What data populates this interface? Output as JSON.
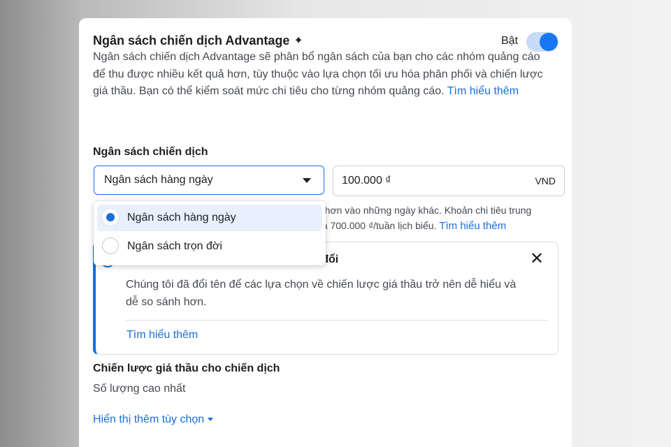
{
  "header": {
    "title": "Ngân sách chiến dịch Advantage",
    "title_icon": "sparkle-icon",
    "toggle_label": "Bật",
    "toggle_on": true
  },
  "description": {
    "text": "Ngân sách chiến dịch Advantage sẽ phân bổ ngân sách của bạn cho các nhóm quảng cáo để thu được nhiều kết quả hơn, tùy thuộc vào lựa chọn tối ưu hóa phân phối và chiến lược giá thầu. Bạn có thể kiểm soát mức chi tiêu cho từng nhóm quảng cáo.",
    "link": "Tìm hiểu thêm"
  },
  "budget": {
    "label": "Ngân sách chiến dịch",
    "type_selected": "Ngân sách hàng ngày",
    "amount": "100.000 ₫",
    "currency": "VND",
    "helper_line1": "ít hơn vào những ngày khác. Khoản chi tiêu trung",
    "helper_line2": "uá 700.000 ₫/tuần lịch biểu.",
    "helper_link": "Tìm hiểu thêm",
    "options": [
      {
        "label": "Ngân sách hàng ngày",
        "selected": true
      },
      {
        "label": "Ngân sách trọn đời",
        "selected": false
      }
    ]
  },
  "notice": {
    "title_partial": "ay đổi",
    "body": "Chúng tôi đã đổi tên để các lựa chọn về chiến lược giá thầu trở nên dễ hiểu và dễ so sánh hơn.",
    "link": "Tìm hiểu thêm",
    "accent_color": "#1a6ed8"
  },
  "strategy": {
    "label": "Chiến lược giá thầu cho chiến dịch",
    "value": "Số lượng cao nhất",
    "more_options": "Hiển thị thêm tùy chọn"
  },
  "colors": {
    "accent": "#1877f2",
    "link": "#1a6ed8",
    "selected_bg": "#e7f0fd"
  }
}
